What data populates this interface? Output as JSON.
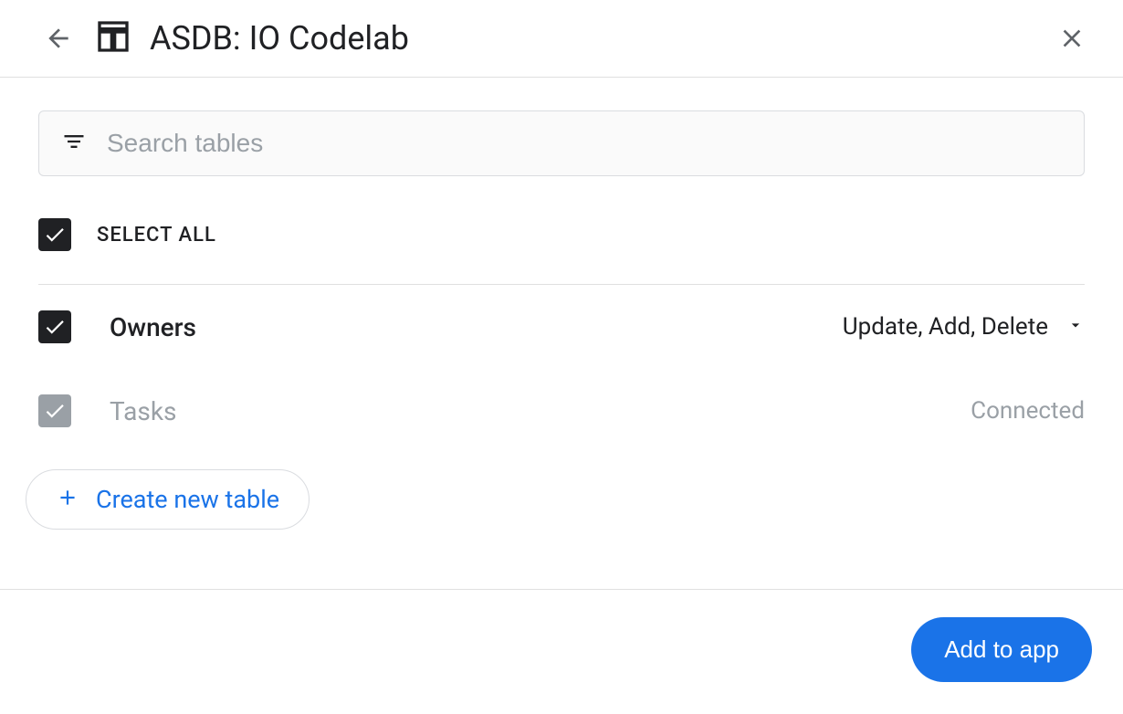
{
  "header": {
    "title": "ASDB: IO Codelab"
  },
  "search": {
    "placeholder": "Search tables"
  },
  "selectAll": {
    "label": "SELECT ALL"
  },
  "tables": [
    {
      "name": "Owners",
      "status": "Update, Add, Delete",
      "checked": true,
      "disabled": false
    },
    {
      "name": "Tasks",
      "status": "Connected",
      "checked": true,
      "disabled": true
    }
  ],
  "createTable": {
    "label": "Create new table"
  },
  "footer": {
    "addButton": "Add to app"
  }
}
